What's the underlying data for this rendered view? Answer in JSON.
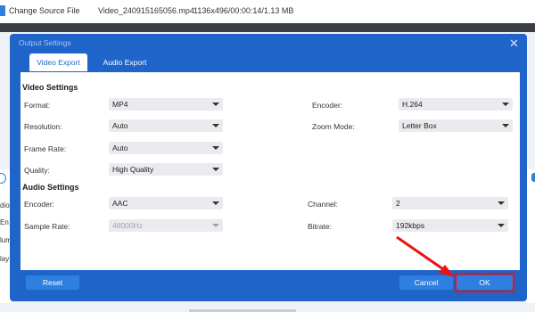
{
  "app": {
    "change_source": "Change Source File",
    "filename": "Video_240915165056.mp4",
    "fileinfo": "1136x496/00:00:14/1.13 MB",
    "side_left": [
      "dio",
      "En",
      "lum",
      "lay"
    ]
  },
  "dialog": {
    "title": "Output Settings",
    "tabs": [
      {
        "label": "Video Export",
        "active": true
      },
      {
        "label": "Audio Export",
        "active": false
      }
    ],
    "video": {
      "heading": "Video Settings",
      "format": {
        "label": "Format:",
        "value": "MP4"
      },
      "resolution": {
        "label": "Resolution:",
        "value": "Auto"
      },
      "frame_rate": {
        "label": "Frame Rate:",
        "value": "Auto"
      },
      "quality": {
        "label": "Quality:",
        "value": "High Quality"
      },
      "encoder": {
        "label": "Encoder:",
        "value": "H.264"
      },
      "zoom_mode": {
        "label": "Zoom Mode:",
        "value": "Letter Box"
      }
    },
    "audio": {
      "heading": "Audio Settings",
      "encoder": {
        "label": "Encoder:",
        "value": "AAC"
      },
      "sample_rate": {
        "label": "Sample Rate:",
        "value": "48000Hz",
        "disabled": true
      },
      "channel": {
        "label": "Channel:",
        "value": "2"
      },
      "bitrate": {
        "label": "Bitrate:",
        "value": "192kbps"
      }
    },
    "buttons": {
      "reset": "Reset",
      "cancel": "Cancel",
      "ok": "OK"
    }
  },
  "colors": {
    "accent": "#2f7fe0",
    "dialog_bg": "#1f65c9",
    "annotation": "#e11111"
  }
}
